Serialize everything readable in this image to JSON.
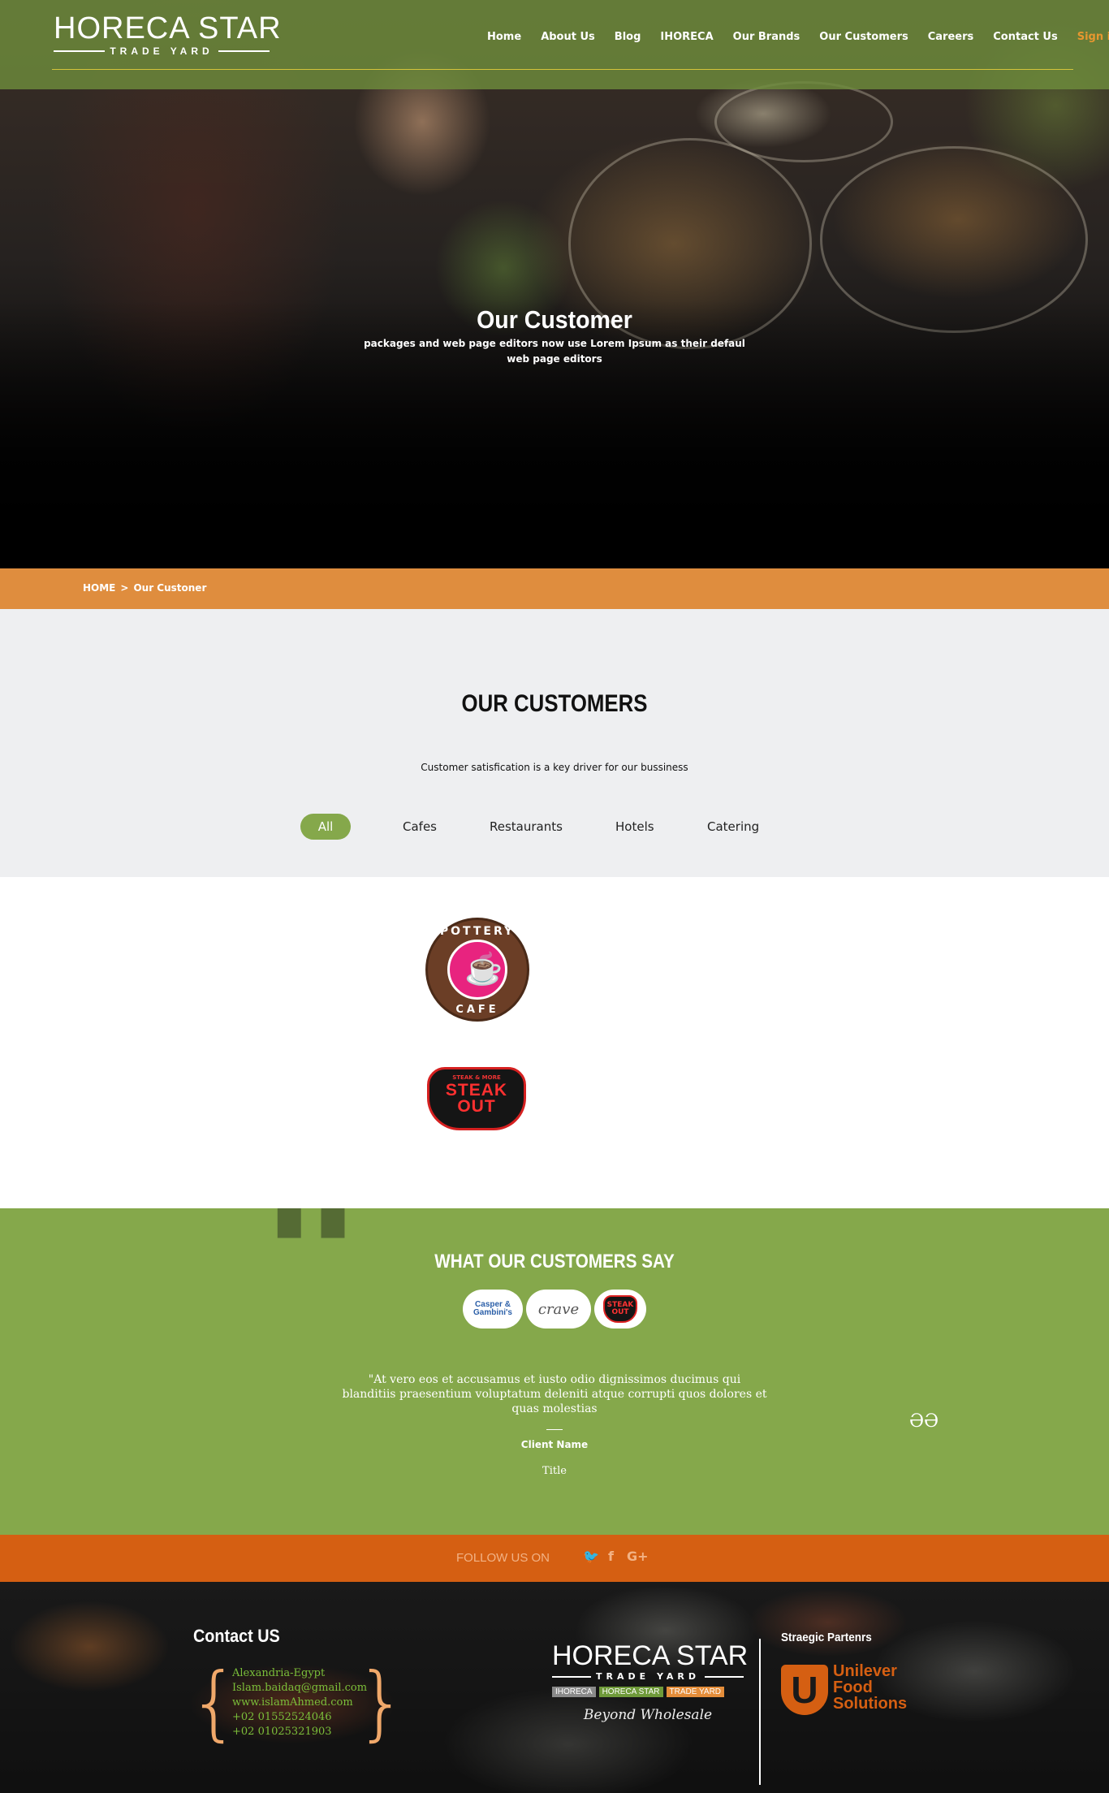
{
  "header": {
    "logo_main": "HORECA STAR",
    "logo_sub": "TRADE YARD",
    "nav": [
      {
        "label": "Home"
      },
      {
        "label": "About Us"
      },
      {
        "label": "Blog"
      },
      {
        "label": "IHORECA"
      },
      {
        "label": "Our Brands"
      },
      {
        "label": "Our Customers"
      },
      {
        "label": "Careers"
      },
      {
        "label": "Contact Us"
      },
      {
        "label": "Sign in"
      }
    ],
    "accent_color": "#e7972f",
    "nav_bg_color": "#6e8c3c"
  },
  "hero": {
    "title": "Our Customer",
    "subtitle": "packages and web page editors now use Lorem Ipsum as their defaul web page editors"
  },
  "breadcrumb": {
    "home": "HOME",
    "separator": ">",
    "current": "Our Custoner",
    "bg_color": "#df8d3e"
  },
  "customers": {
    "title": "OUR CUSTOMERS",
    "subtitle": "Customer satisfication is a key driver for our bussiness",
    "filters": [
      {
        "label": "All",
        "active": true
      },
      {
        "label": "Cafes",
        "active": false
      },
      {
        "label": "Restaurants",
        "active": false
      },
      {
        "label": "Hotels",
        "active": false
      },
      {
        "label": "Catering",
        "active": false
      }
    ],
    "logos": [
      {
        "name": "Pottery Cafe",
        "top_text": "POTTERY",
        "bottom_text": "CAFE",
        "icon": "coffee-cup-icon"
      },
      {
        "name": "Steak Out",
        "top_text": "STEAK & MORE",
        "main_text": "STEAK OUT"
      }
    ],
    "active_filter_color": "#85a84b"
  },
  "testimonials": {
    "title": "WHAT OUR CUSTOMERS SAY",
    "avatars": [
      {
        "label": "Casper & Gambini's"
      },
      {
        "label": "crave"
      },
      {
        "label": "STEAK OUT"
      }
    ],
    "quote": "\"At vero eos et accusamus et iusto odio dignissimos ducimus qui blanditiis praesentium voluptatum deleniti atque corrupti quos dolores et quas molestias",
    "client_name": "Client Name",
    "client_title": "Title",
    "bg_color": "#85a84b"
  },
  "follow": {
    "label": "FOLLOW US ON",
    "icons": [
      "twitter-icon",
      "facebook-icon",
      "google-plus-icon"
    ],
    "icon_glyphs": [
      "🐦",
      "f",
      "G+"
    ],
    "bg_color": "#d55f12"
  },
  "footer": {
    "contact_title": "Contact US",
    "contact_lines": [
      "Alexandria-Egypt",
      "Islam.baidaq@gmail.com",
      "www.islamAhmed.com",
      "+02 01552524046",
      "+02 01025321903"
    ],
    "logo_main": "HORECA STAR",
    "logo_sub": "TRADE YARD",
    "tags": [
      "IHORECA",
      "HORECA STAR",
      "TRADE YARD"
    ],
    "slogan": "Beyond Wholesale",
    "partners_title": "Straegic Partenrs",
    "partner_lines": [
      "Unilever",
      "Food",
      "Solutions"
    ],
    "partner_icon_letter": "U"
  }
}
